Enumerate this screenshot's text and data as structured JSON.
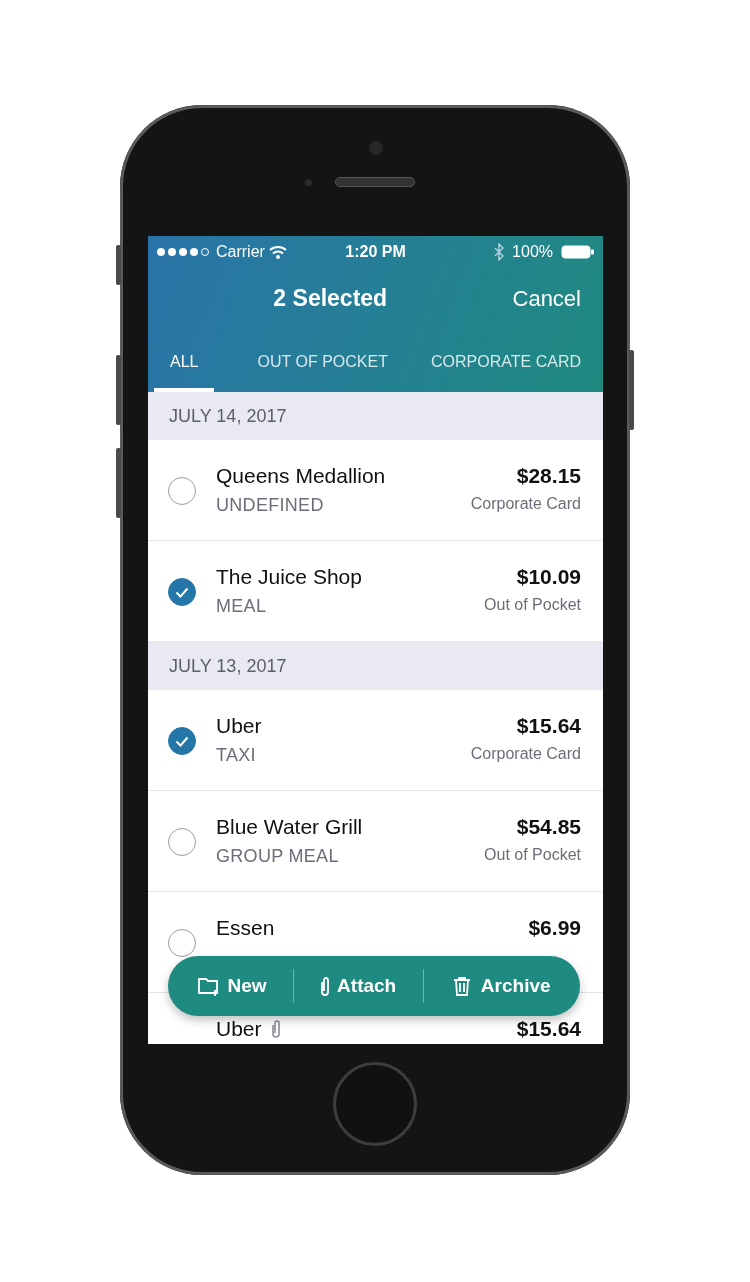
{
  "status_bar": {
    "carrier": "Carrier",
    "time": "1:20 PM",
    "battery": "100%"
  },
  "header": {
    "title": "2 Selected",
    "action": "Cancel"
  },
  "tabs": [
    {
      "label": "ALL",
      "selected": true
    },
    {
      "label": "OUT OF POCKET",
      "selected": false
    },
    {
      "label": "CORPORATE CARD",
      "selected": false
    }
  ],
  "sections": [
    {
      "date": "JULY 14, 2017",
      "items": [
        {
          "name": "Queens Medallion",
          "category": "UNDEFINED",
          "amount": "$28.15",
          "payment": "Corporate Card",
          "selected": false
        },
        {
          "name": "The Juice Shop",
          "category": "MEAL",
          "amount": "$10.09",
          "payment": "Out of Pocket",
          "selected": true
        }
      ]
    },
    {
      "date": "JULY 13, 2017",
      "items": [
        {
          "name": "Uber",
          "category": "TAXI",
          "amount": "$15.64",
          "payment": "Corporate Card",
          "selected": true
        },
        {
          "name": "Blue Water Grill",
          "category": "GROUP MEAL",
          "amount": "$54.85",
          "payment": "Out of Pocket",
          "selected": false
        },
        {
          "name": "Essen",
          "amount": "$6.99",
          "selected": false
        },
        {
          "name": "Uber",
          "amount": "$15.64",
          "attachment": true
        }
      ]
    }
  ],
  "actions": [
    {
      "label": "New",
      "kind": "folder"
    },
    {
      "label": "Attach",
      "kind": "clip"
    },
    {
      "label": "Archive",
      "kind": "trash"
    }
  ]
}
